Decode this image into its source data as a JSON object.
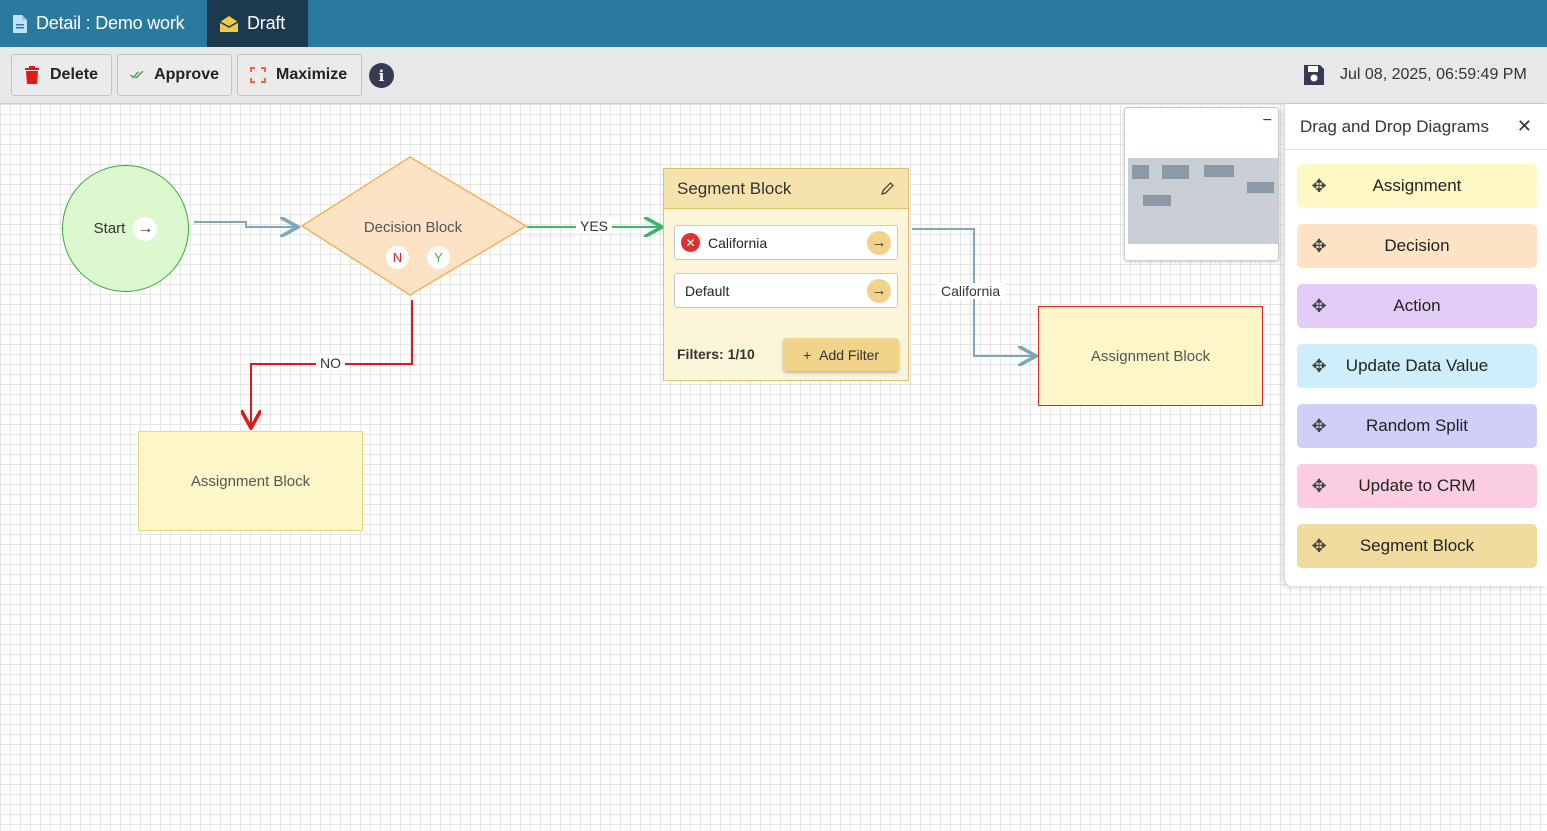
{
  "tabs": {
    "detail_label": "Detail : Demo work",
    "draft_label": "Draft"
  },
  "toolbar": {
    "delete_label": "Delete",
    "approve_label": "Approve",
    "maximize_label": "Maximize",
    "info_glyph": "i",
    "timestamp": "Jul 08, 2025, 06:59:49 PM"
  },
  "diagram": {
    "start_label": "Start",
    "arrow_glyph": "→",
    "decision_label": "Decision Block",
    "decision_no_pill": "N",
    "decision_yes_pill": "Y",
    "edge_yes": "YES",
    "edge_no": "NO",
    "edge_california": "California",
    "segment": {
      "title": "Segment Block",
      "rows": [
        "California",
        "Default"
      ],
      "remove_glyph": "✕",
      "filters_text": "Filters: 1/10",
      "add_filter_label": "Add Filter",
      "add_glyph": "+"
    },
    "assignment_left_label": "Assignment Block",
    "assignment_right_label": "Assignment Block"
  },
  "minimap": {
    "collapse_glyph": "−"
  },
  "palette": {
    "title": "Drag and Drop Diagrams",
    "close_glyph": "✕",
    "move_glyph": "✥",
    "items": [
      {
        "label": "Assignment",
        "color": "#fdf8c4"
      },
      {
        "label": "Decision",
        "color": "#fde3c6"
      },
      {
        "label": "Action",
        "color": "#e3cdf7"
      },
      {
        "label": "Update Data Value",
        "color": "#cdeefa"
      },
      {
        "label": "Random Split",
        "color": "#cfcff7"
      },
      {
        "label": "Update to CRM",
        "color": "#fbcde0"
      },
      {
        "label": "Segment Block",
        "color": "#f0dc9e"
      }
    ]
  },
  "colors": {
    "titlebar": "#2a7aa0",
    "draft_tab": "#1c3a4d",
    "edge_default": "#7ea8b8",
    "edge_yes": "#3db66c",
    "edge_no": "#e01818"
  }
}
